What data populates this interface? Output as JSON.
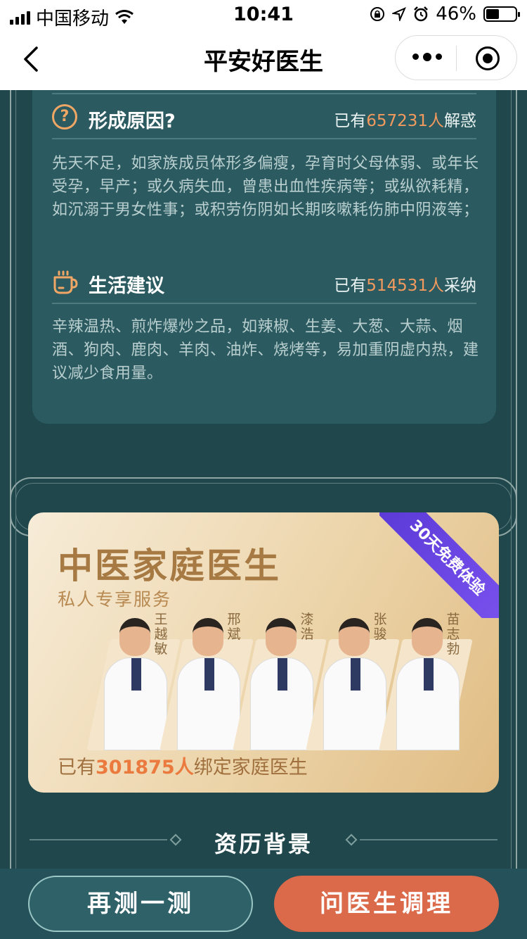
{
  "status_bar": {
    "carrier": "中国移动",
    "time": "10:41",
    "battery": "46%",
    "battery_level": 0.46,
    "icons": [
      "signal-icon",
      "wifi-icon",
      "lock-rotation-icon",
      "location-icon",
      "alarm-icon",
      "battery-icon"
    ]
  },
  "nav": {
    "title": "平安好医生",
    "icons": [
      "back-icon",
      "more-icon",
      "target-icon"
    ]
  },
  "cause": {
    "title": "形成原因?",
    "stat_prefix": "已有",
    "stat_num": "657231人",
    "stat_suffix": "解惑",
    "text": "先天不足，如家族成员体形多偏瘦，孕育时父母体弱、或年长受孕，早产；或久病失血，曾患出血性疾病等；或纵欲耗精，如沉溺于男女性事；或积劳伤阴如长期咳嗽耗伤肺中阴液等；",
    "icon": "question-icon"
  },
  "advice": {
    "title": "生活建议",
    "stat_prefix": "已有",
    "stat_num": "514531人",
    "stat_suffix": "采纳",
    "text": "辛辣温热、煎炸爆炒之品，如辣椒、生姜、大葱、大蒜、烟酒、狗肉、鹿肉、羊肉、油炸、烧烤等，易加重阴虚内热，建议减少食用量。",
    "icon": "tea-cup-icon"
  },
  "banner": {
    "title": "中医家庭医生",
    "subtitle": "私人专享服务",
    "ribbon": "30天免费体验",
    "doctors": [
      "王越敏",
      "邢斌",
      "漆浩",
      "张骏",
      "苗志勃"
    ],
    "foot_prefix": "已有",
    "foot_num": "301875人",
    "foot_suffix": "绑定家庭医生"
  },
  "qualification": {
    "title": "资历背景"
  },
  "actions": {
    "retest": "再测一测",
    "ask": "问医生调理"
  },
  "colors": {
    "background": "#1f474c",
    "card": "#2b5a60",
    "accent_orange": "#f29a5e",
    "ask_button": "#db6a4b",
    "ribbon": "#6a45e0"
  }
}
